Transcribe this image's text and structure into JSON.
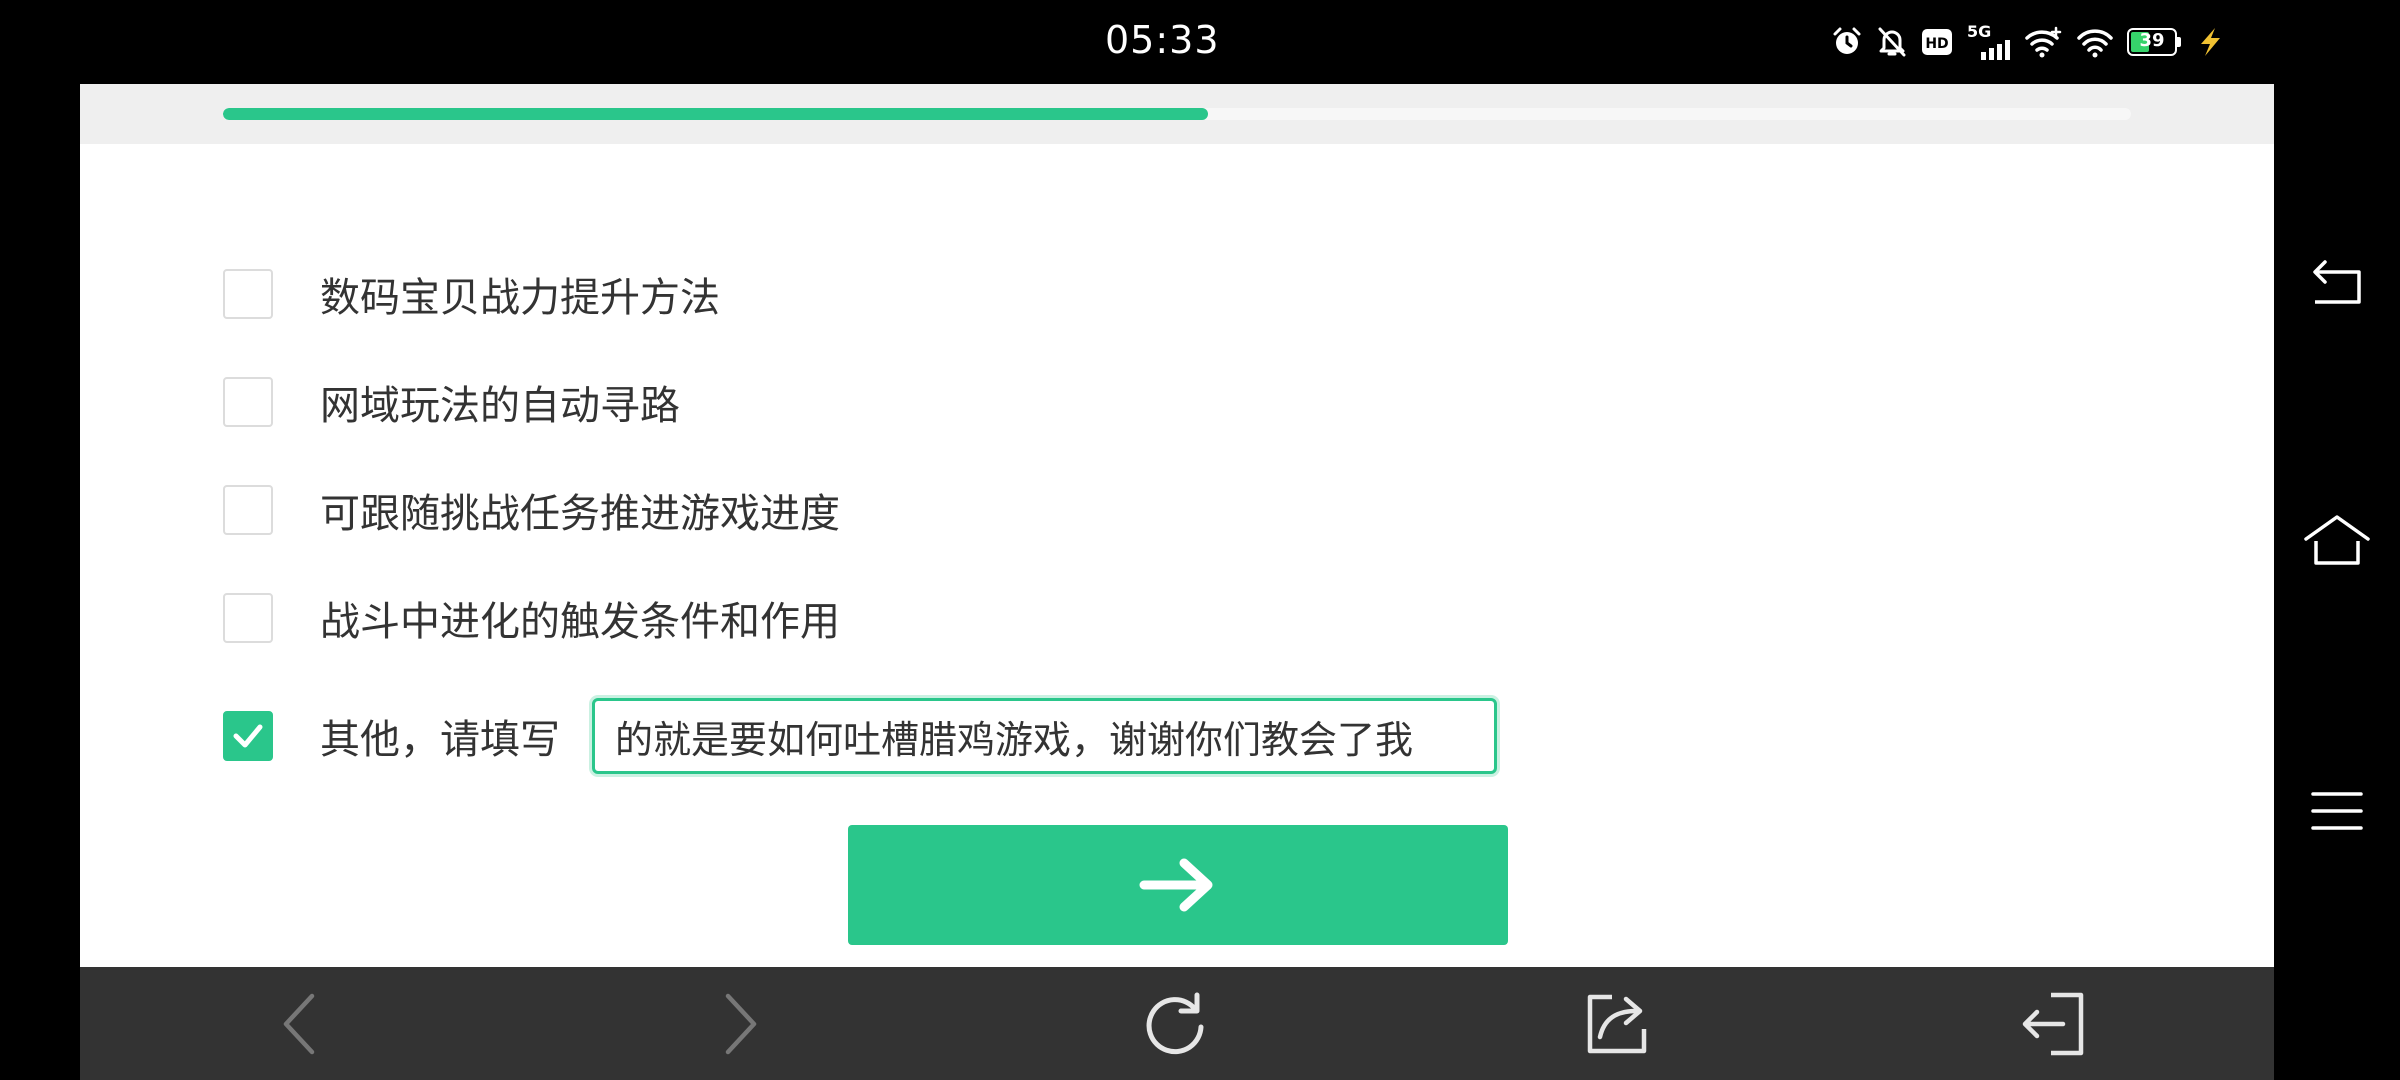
{
  "status_bar": {
    "time": "05:33",
    "network_label": "5G",
    "battery_level": "39",
    "icons": [
      "alarm-icon",
      "bell-off-icon",
      "hd-icon",
      "signal-5g-icon",
      "wifi-plus-icon",
      "wifi-icon",
      "battery-icon",
      "charging-icon"
    ]
  },
  "progress": {
    "fraction": 0.516
  },
  "options": [
    {
      "label": "数码宝贝战力提升方法",
      "checked": false
    },
    {
      "label": "网域玩法的自动寻路",
      "checked": false
    },
    {
      "label": "可跟随挑战任务推进游戏进度",
      "checked": false
    },
    {
      "label": "战斗中进化的触发条件和作用",
      "checked": false
    },
    {
      "label": "其他，请填写",
      "checked": true
    }
  ],
  "other_input": {
    "value": "的就是要如何吐槽腊鸡游戏，谢谢你们教会了我"
  },
  "next_button": {
    "icon": "arrow-right-icon"
  },
  "toolbar": {
    "icons": [
      "back-arrow-icon",
      "forward-arrow-icon",
      "refresh-icon",
      "share-icon",
      "exit-icon"
    ]
  },
  "side_nav": {
    "icons": [
      "nav-back-icon",
      "nav-home-icon",
      "nav-menu-icon"
    ]
  },
  "colors": {
    "accent": "#2ac68b",
    "toolbar_bg": "#333333",
    "progress_bg": "#efefef"
  }
}
